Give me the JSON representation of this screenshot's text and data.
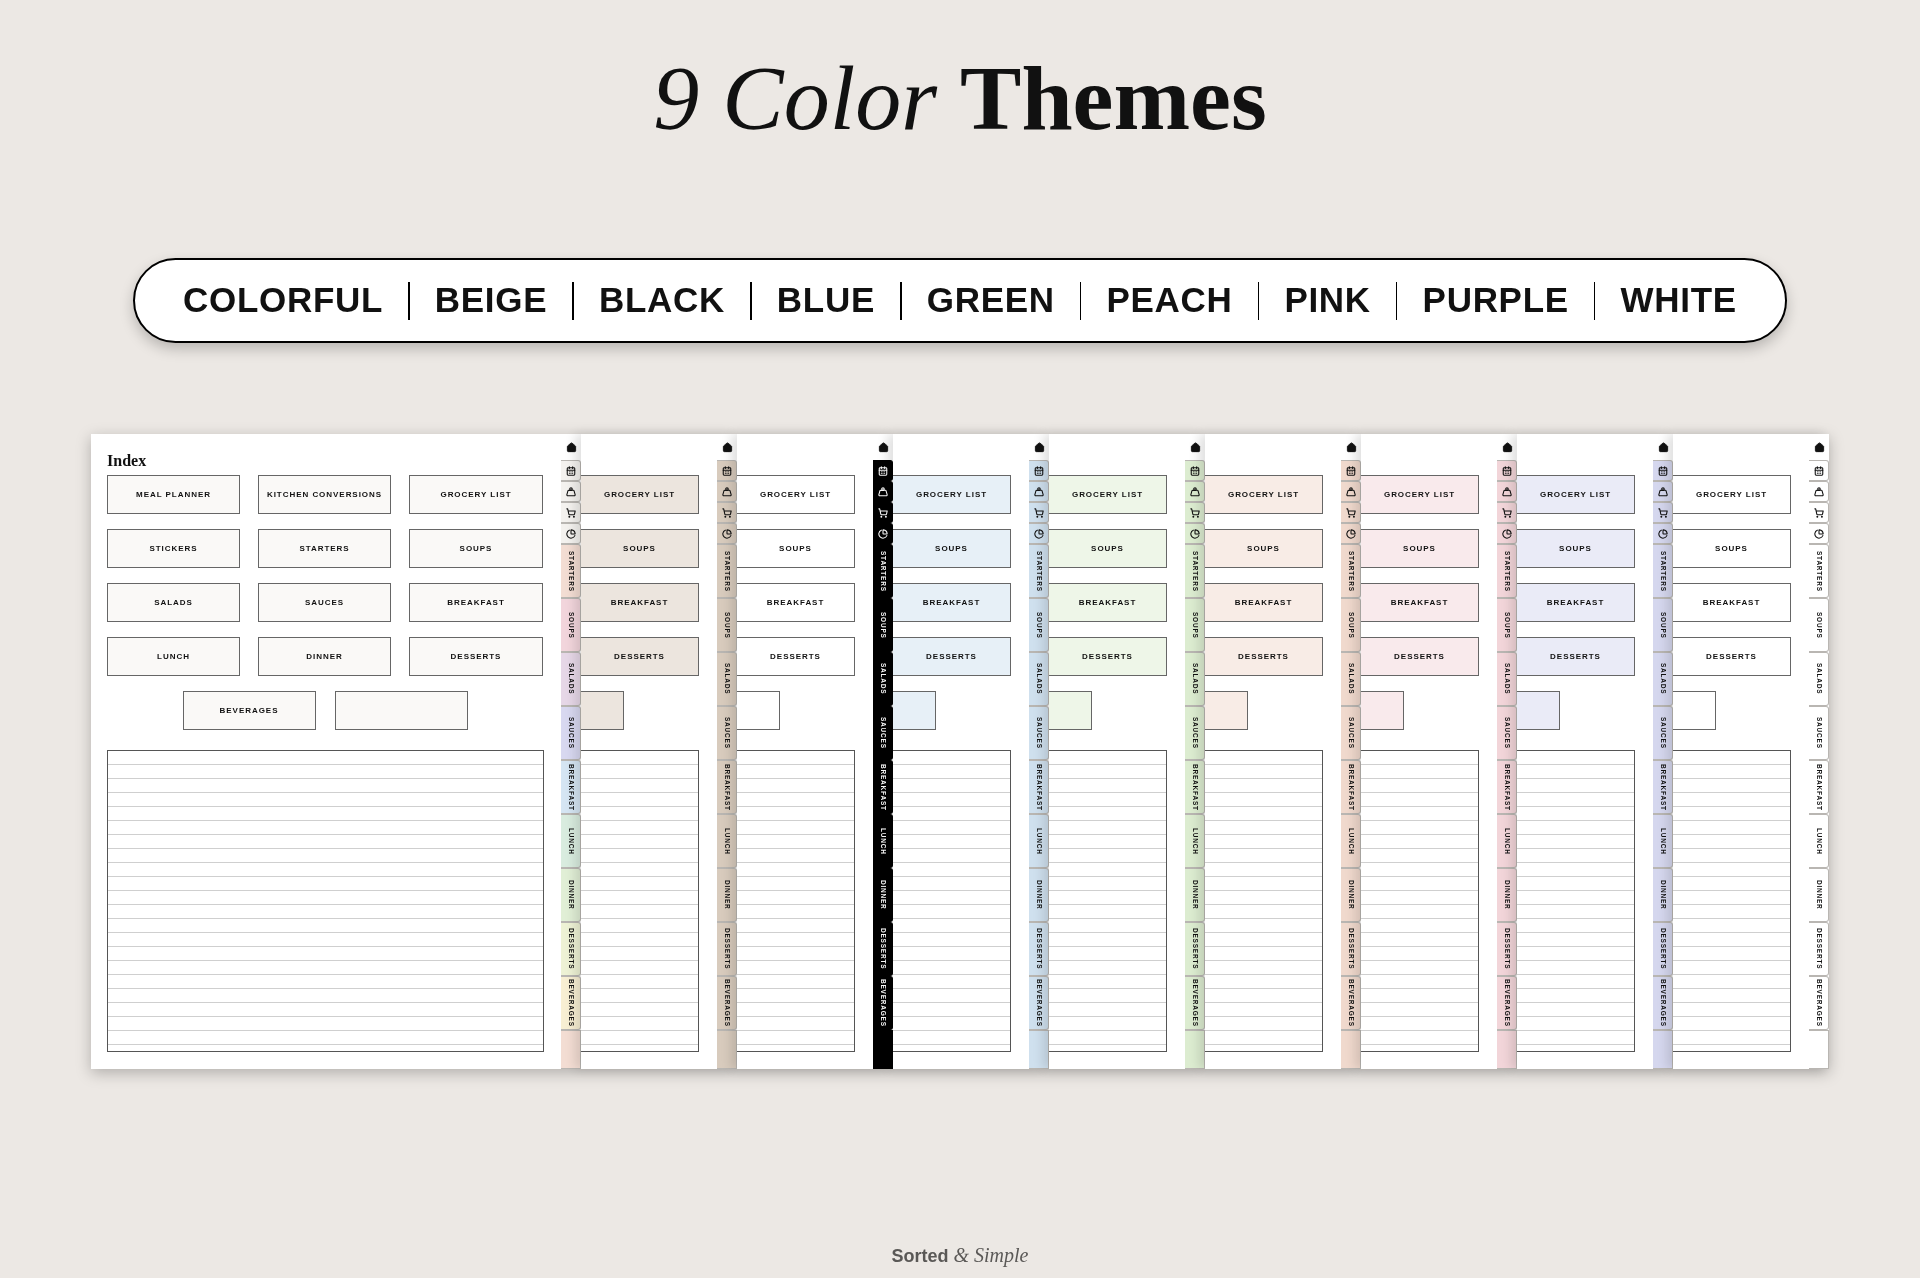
{
  "title": "*9 Color* **Themes**",
  "themes": [
    "COLORFUL",
    "BEIGE",
    "BLACK",
    "BLUE",
    "GREEN",
    "PEACH",
    "PINK",
    "PURPLE",
    "WHITE"
  ],
  "pages": [
    {
      "kind": "index",
      "title": "Index",
      "dark": false,
      "color": "#f4f2ef",
      "buttons": [
        "MEAL PLANNER",
        "KITCHEN CONVERSIONS",
        "GROCERY LIST",
        "STICKERS",
        "STARTERS",
        "SOUPS",
        "SALADS",
        "SAUCES",
        "BREAKFAST",
        "LUNCH",
        "DINNER",
        "DESSERTS",
        "BEVERAGES"
      ],
      "tabs": [
        {
          "label": "STARTERS",
          "color": "#f3ddd3"
        },
        {
          "label": "SOUPS",
          "color": "#f2d5dc"
        },
        {
          "label": "SALADS",
          "color": "#e6d7e7"
        },
        {
          "label": "SAUCES",
          "color": "#d8d8f0"
        },
        {
          "label": "BREAKFAST",
          "color": "#d5e5f3"
        },
        {
          "label": "LUNCH",
          "color": "#d9ecdf"
        },
        {
          "label": "DINNER",
          "color": "#e1efd6"
        },
        {
          "label": "DESSERTS",
          "color": "#eef2d5"
        },
        {
          "label": "BEVERAGES",
          "color": "#f8efd3"
        }
      ]
    },
    {
      "kind": "preview",
      "dark": false,
      "color": "#d8cbbd",
      "buttons": [
        "GROCERY LIST",
        "SOUPS",
        "BREAKFAST",
        "DESSERTS"
      ],
      "tabs": [
        {
          "label": "STARTERS"
        },
        {
          "label": "SOUPS"
        },
        {
          "label": "SALADS"
        },
        {
          "label": "SAUCES"
        },
        {
          "label": "BREAKFAST"
        },
        {
          "label": "LUNCH"
        },
        {
          "label": "DINNER"
        },
        {
          "label": "DESSERTS"
        },
        {
          "label": "BEVERAGES"
        }
      ]
    },
    {
      "kind": "preview",
      "dark": true,
      "color": "#000000",
      "buttons": [
        "GROCERY LIST",
        "SOUPS",
        "BREAKFAST",
        "DESSERTS"
      ],
      "tabs": [
        {
          "label": "STARTERS"
        },
        {
          "label": "SOUPS"
        },
        {
          "label": "SALADS"
        },
        {
          "label": "SAUCES"
        },
        {
          "label": "BREAKFAST"
        },
        {
          "label": "LUNCH"
        },
        {
          "label": "DINNER"
        },
        {
          "label": "DESSERTS"
        },
        {
          "label": "BEVERAGES"
        }
      ]
    },
    {
      "kind": "preview",
      "dark": false,
      "color": "#cfe0ee",
      "buttons": [
        "GROCERY LIST",
        "SOUPS",
        "BREAKFAST",
        "DESSERTS"
      ],
      "tabs": [
        {
          "label": "STARTERS"
        },
        {
          "label": "SOUPS"
        },
        {
          "label": "SALADS"
        },
        {
          "label": "SAUCES"
        },
        {
          "label": "BREAKFAST"
        },
        {
          "label": "LUNCH"
        },
        {
          "label": "DINNER"
        },
        {
          "label": "DESSERTS"
        },
        {
          "label": "BEVERAGES"
        }
      ]
    },
    {
      "kind": "preview",
      "dark": false,
      "color": "#dcecd0",
      "buttons": [
        "GROCERY LIST",
        "SOUPS",
        "BREAKFAST",
        "DESSERTS"
      ],
      "tabs": [
        {
          "label": "STARTERS"
        },
        {
          "label": "SOUPS"
        },
        {
          "label": "SALADS"
        },
        {
          "label": "SAUCES"
        },
        {
          "label": "BREAKFAST"
        },
        {
          "label": "LUNCH"
        },
        {
          "label": "DINNER"
        },
        {
          "label": "DESSERTS"
        },
        {
          "label": "BEVERAGES"
        }
      ]
    },
    {
      "kind": "preview",
      "dark": false,
      "color": "#f0d9cd",
      "buttons": [
        "GROCERY LIST",
        "SOUPS",
        "BREAKFAST",
        "DESSERTS"
      ],
      "tabs": [
        {
          "label": "STARTERS"
        },
        {
          "label": "SOUPS"
        },
        {
          "label": "SALADS"
        },
        {
          "label": "SAUCES"
        },
        {
          "label": "BREAKFAST"
        },
        {
          "label": "LUNCH"
        },
        {
          "label": "DINNER"
        },
        {
          "label": "DESSERTS"
        },
        {
          "label": "BEVERAGES"
        }
      ]
    },
    {
      "kind": "preview",
      "dark": false,
      "color": "#f2d5d9",
      "buttons": [
        "GROCERY LIST",
        "SOUPS",
        "BREAKFAST",
        "DESSERTS"
      ],
      "tabs": [
        {
          "label": "STARTERS"
        },
        {
          "label": "SOUPS"
        },
        {
          "label": "SALADS"
        },
        {
          "label": "SAUCES"
        },
        {
          "label": "BREAKFAST"
        },
        {
          "label": "LUNCH"
        },
        {
          "label": "DINNER"
        },
        {
          "label": "DESSERTS"
        },
        {
          "label": "BEVERAGES"
        }
      ]
    },
    {
      "kind": "preview",
      "dark": false,
      "color": "#d5d7ee",
      "buttons": [
        "GROCERY LIST",
        "SOUPS",
        "BREAKFAST",
        "DESSERTS"
      ],
      "tabs": [
        {
          "label": "STARTERS"
        },
        {
          "label": "SOUPS"
        },
        {
          "label": "SALADS"
        },
        {
          "label": "SAUCES"
        },
        {
          "label": "BREAKFAST"
        },
        {
          "label": "LUNCH"
        },
        {
          "label": "DINNER"
        },
        {
          "label": "DESSERTS"
        },
        {
          "label": "BEVERAGES"
        }
      ]
    },
    {
      "kind": "preview",
      "dark": false,
      "color": "#ffffff",
      "buttons": [
        "GROCERY LIST",
        "SOUPS",
        "BREAKFAST",
        "DESSERTS"
      ],
      "tabs": [
        {
          "label": "STARTERS"
        },
        {
          "label": "SOUPS"
        },
        {
          "label": "SALADS"
        },
        {
          "label": "SAUCES"
        },
        {
          "label": "BREAKFAST"
        },
        {
          "label": "LUNCH"
        },
        {
          "label": "DINNER"
        },
        {
          "label": "DESSERTS"
        },
        {
          "label": "BEVERAGES"
        }
      ]
    }
  ],
  "brand": {
    "first": "Sorted",
    "second": "& Simple"
  }
}
